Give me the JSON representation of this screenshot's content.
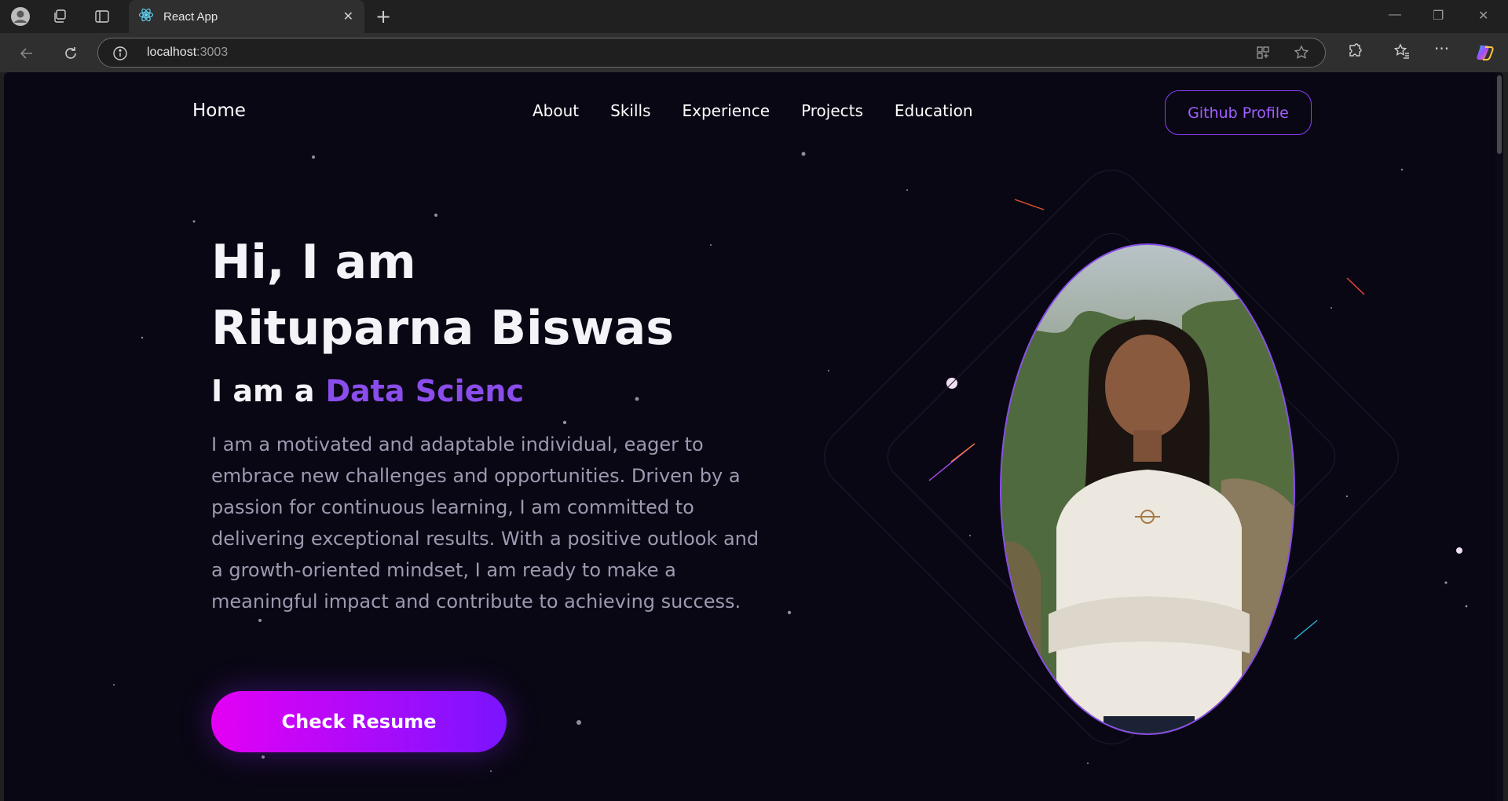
{
  "browser": {
    "tab_title": "React App",
    "tab_close": "✕",
    "new_tab": "+",
    "url_host": "localhost",
    "url_port": ":3003",
    "window_controls": [
      "—",
      "❐",
      "✕"
    ]
  },
  "nav": {
    "home": "Home",
    "links": [
      "About",
      "Skills",
      "Experience",
      "Projects",
      "Education"
    ],
    "github_button": "Github Profile"
  },
  "hero": {
    "greeting": "Hi, I am",
    "name": "Rituparna Biswas",
    "role_prefix": "I am a",
    "role_typed": "Data Scienc",
    "description": "I am a motivated and adaptable individual, eager to embrace new challenges and opportunities. Driven by a passion for continuous learning, I am committed to delivering exceptional results. With a positive outlook and a growth-oriented mindset, I am ready to make a meaningful impact and contribute to achieving success.",
    "resume_button": "Check Resume"
  },
  "colors": {
    "page_bg": "#0a0714",
    "accent_purple": "#8a4dec",
    "button_gradient_start": "#e400f4",
    "button_gradient_end": "#7a14ff"
  },
  "icons": {
    "profile": "profile-avatar-icon",
    "workspaces": "workspaces-icon",
    "tab_actions": "vertical-tabs-icon",
    "favicon": "react-logo-icon",
    "back": "back-arrow-icon",
    "refresh": "refresh-icon",
    "site_info": "info-icon",
    "app_available": "app-available-icon",
    "favorite": "star-icon",
    "extensions": "puzzle-icon",
    "favorites": "favorites-icon",
    "menu": "more-icon",
    "copilot": "copilot-icon"
  }
}
